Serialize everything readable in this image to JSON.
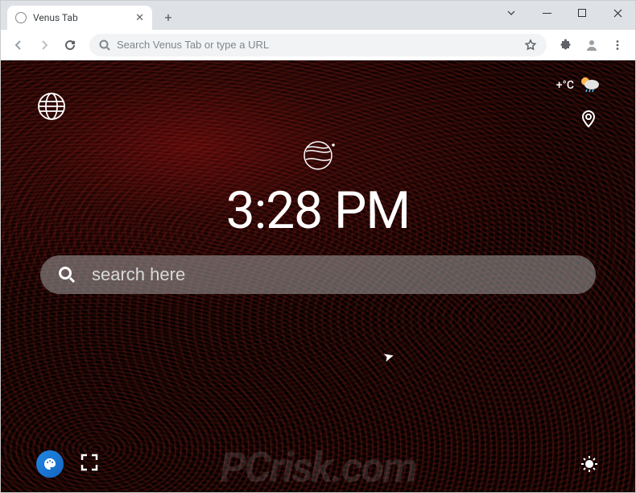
{
  "tab": {
    "title": "Venus Tab"
  },
  "omnibox": {
    "placeholder": "Search Venus Tab or type a URL"
  },
  "weather": {
    "temp": "+°C"
  },
  "clock": {
    "time": "3:28 PM"
  },
  "search": {
    "placeholder": "search here"
  },
  "watermark": {
    "text": "PCrisk.com"
  },
  "icons": {
    "globe": "globe-icon",
    "location": "location-icon",
    "planet": "planet-logo",
    "palette": "palette-icon",
    "fullscreen": "fullscreen-icon",
    "brightness": "brightness-icon",
    "search": "search-icon",
    "star": "star-icon",
    "extension": "extension-icon",
    "profile": "profile-icon",
    "menu": "menu-icon"
  }
}
